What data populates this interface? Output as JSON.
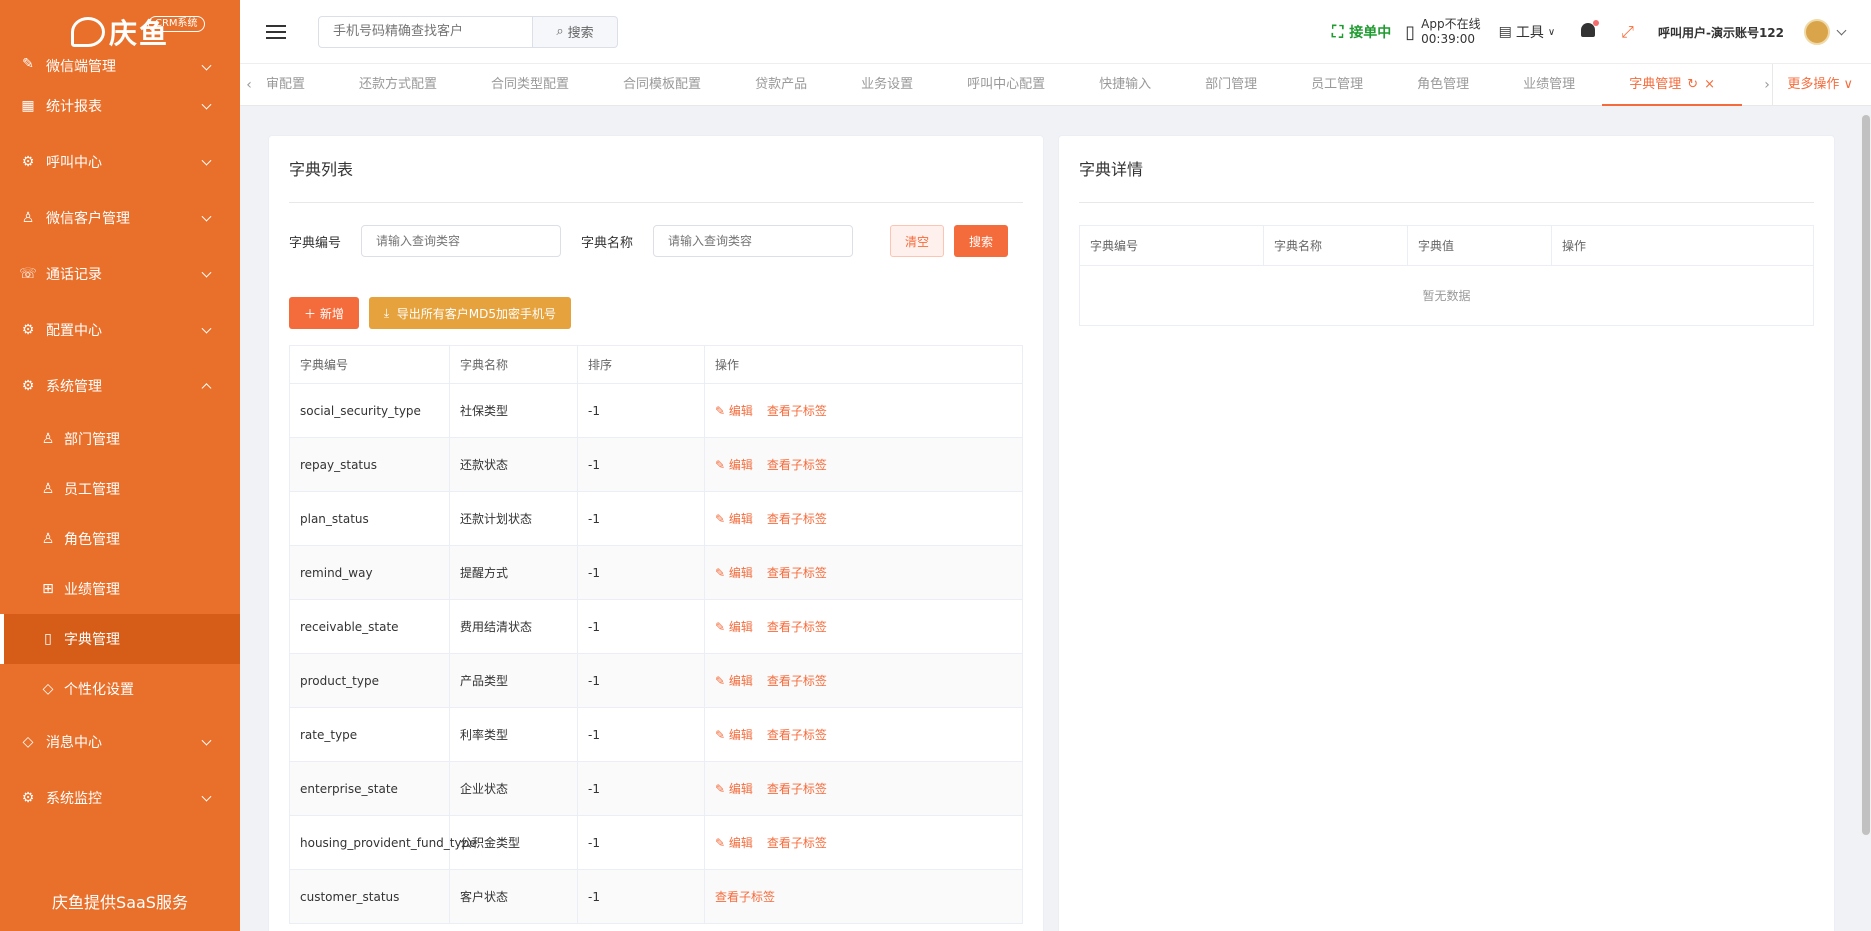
{
  "sidebar": {
    "logo_text": "庆鱼",
    "logo_badge": "CRM系统",
    "menu_top": [
      {
        "label": "微信端管理",
        "icon": "edit-icon"
      },
      {
        "label": "统计报表",
        "icon": "table-icon"
      },
      {
        "label": "呼叫中心",
        "icon": "gear-icon"
      },
      {
        "label": "微信客户管理",
        "icon": "user-icon"
      },
      {
        "label": "通话记录",
        "icon": "phone-icon"
      },
      {
        "label": "配置中心",
        "icon": "gear-icon"
      },
      {
        "label": "系统管理",
        "icon": "gear-icon"
      }
    ],
    "sub_items": [
      {
        "label": "部门管理",
        "icon": "user-icon"
      },
      {
        "label": "员工管理",
        "icon": "user-icon"
      },
      {
        "label": "角色管理",
        "icon": "user-icon"
      },
      {
        "label": "业绩管理",
        "icon": "grid-icon"
      },
      {
        "label": "字典管理",
        "icon": "book-icon"
      },
      {
        "label": "个性化设置",
        "icon": "tag-icon"
      }
    ],
    "menu_bottom": [
      {
        "label": "消息中心",
        "icon": "tag-icon"
      },
      {
        "label": "系统监控",
        "icon": "gear-icon"
      }
    ],
    "footer": "庆鱼提供SaaS服务"
  },
  "header": {
    "search_placeholder": "手机号码精确查找客户",
    "search_button": "搜索",
    "working_status": "接单中",
    "app_status_line1": "App不在线",
    "app_status_line2": "00:39:00",
    "tools_label": "工具",
    "user_name": "呼叫用户-演示账号122"
  },
  "tabs": {
    "items": [
      "审配置",
      "还款方式配置",
      "合同类型配置",
      "合同模板配置",
      "贷款产品",
      "业务设置",
      "呼叫中心配置",
      "快捷输入",
      "部门管理",
      "员工管理",
      "角色管理",
      "业绩管理",
      "字典管理"
    ],
    "active_index": 12,
    "more_label": "更多操作"
  },
  "dict_list": {
    "title": "字典列表",
    "filter": {
      "code_label": "字典编号",
      "code_placeholder": "请输入查询类容",
      "name_label": "字典名称",
      "name_placeholder": "请输入查询类容",
      "clear_label": "清空",
      "search_label": "搜索"
    },
    "add_label": "新增",
    "export_label": "导出所有客户MD5加密手机号",
    "columns": [
      "字典编号",
      "字典名称",
      "排序",
      "操作"
    ],
    "edit_label": "编辑",
    "view_label": "查看子标签",
    "rows": [
      {
        "code": "social_security_type",
        "name": "社保类型",
        "sort": "-1",
        "editable": true
      },
      {
        "code": "repay_status",
        "name": "还款状态",
        "sort": "-1",
        "editable": true
      },
      {
        "code": "plan_status",
        "name": "还款计划状态",
        "sort": "-1",
        "editable": true
      },
      {
        "code": "remind_way",
        "name": "提醒方式",
        "sort": "-1",
        "editable": true
      },
      {
        "code": "receivable_state",
        "name": "费用结清状态",
        "sort": "-1",
        "editable": true
      },
      {
        "code": "product_type",
        "name": "产品类型",
        "sort": "-1",
        "editable": true
      },
      {
        "code": "rate_type",
        "name": "利率类型",
        "sort": "-1",
        "editable": true
      },
      {
        "code": "enterprise_state",
        "name": "企业状态",
        "sort": "-1",
        "editable": true
      },
      {
        "code": "housing_provident_fund_type",
        "name": "公积金类型",
        "sort": "-1",
        "editable": true
      },
      {
        "code": "customer_status",
        "name": "客户状态",
        "sort": "-1",
        "editable": false
      }
    ]
  },
  "dict_detail": {
    "title": "字典详情",
    "columns": [
      "字典编号",
      "字典名称",
      "字典值",
      "操作"
    ],
    "empty_text": "暂无数据"
  },
  "colors": {
    "brand": "#e9702a",
    "accent": "#f56c3c",
    "warning": "#e6a23c",
    "online": "#1f9b30"
  }
}
